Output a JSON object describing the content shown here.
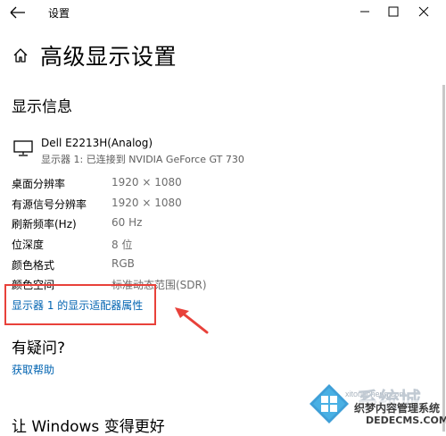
{
  "window": {
    "title": "设置",
    "controls": {
      "minimize": "minimize-icon",
      "maximize": "maximize-icon",
      "close": "close-icon"
    }
  },
  "page": {
    "title": "高级显示设置"
  },
  "display_info": {
    "heading": "显示信息",
    "monitor_name": "Dell E2213H(Analog)",
    "monitor_sub": "显示器 1: 已连接到 NVIDIA GeForce GT 730",
    "rows": [
      {
        "label": "桌面分辨率",
        "value": "1920 × 1080"
      },
      {
        "label": "有源信号分辨率",
        "value": "1920 × 1080"
      },
      {
        "label": "刷新频率(Hz)",
        "value": "60 Hz"
      },
      {
        "label": "位深度",
        "value": "8 位"
      },
      {
        "label": "颜色格式",
        "value": "RGB"
      },
      {
        "label": "颜色空间",
        "value": "标准动态范围(SDR)"
      }
    ],
    "adapter_link": "显示器 1 的显示适配器属性"
  },
  "help": {
    "heading": "有疑问?",
    "link": "获取帮助"
  },
  "improve": {
    "heading": "让 Windows 变得更好"
  },
  "watermark": {
    "text1": "xitongcheng.com",
    "text2": "系统城",
    "text3": "织梦内容管理系统",
    "text4": "DEDECMS.COM"
  },
  "colors": {
    "link": "#0063b1",
    "highlight_box": "#e8413a",
    "arrow": "#e8413a"
  }
}
